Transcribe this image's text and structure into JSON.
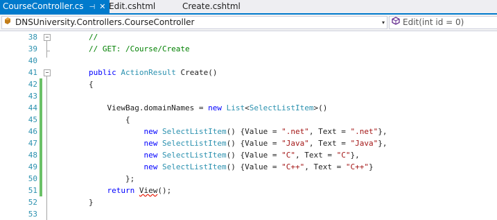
{
  "tabs": [
    {
      "label": "CourseController.cs",
      "active": true
    },
    {
      "label": "Edit.cshtml",
      "active": false
    },
    {
      "label": "Create.cshtml",
      "active": false
    }
  ],
  "navbar": {
    "class_selector": "DNSUniversity.Controllers.CourseController",
    "member_selector": "Edit(int id = 0)"
  },
  "editor": {
    "lines": [
      {
        "num": "38",
        "tokens": [
          {
            "t": "        //",
            "c": "cm"
          }
        ]
      },
      {
        "num": "39",
        "tokens": [
          {
            "t": "        // GET: /Course/Create",
            "c": "cm"
          }
        ]
      },
      {
        "num": "40",
        "tokens": [
          {
            "t": "",
            "c": "pl"
          }
        ]
      },
      {
        "num": "41",
        "tokens": [
          {
            "t": "        ",
            "c": "pl"
          },
          {
            "t": "public",
            "c": "kw"
          },
          {
            "t": " ",
            "c": "pl"
          },
          {
            "t": "ActionResult",
            "c": "ty"
          },
          {
            "t": " Create()",
            "c": "pl"
          }
        ]
      },
      {
        "num": "42",
        "tokens": [
          {
            "t": "        {",
            "c": "pl"
          }
        ]
      },
      {
        "num": "43",
        "tokens": [
          {
            "t": "",
            "c": "pl"
          }
        ]
      },
      {
        "num": "44",
        "tokens": [
          {
            "t": "            ViewBag.domainNames = ",
            "c": "pl"
          },
          {
            "t": "new",
            "c": "kw"
          },
          {
            "t": " ",
            "c": "pl"
          },
          {
            "t": "List",
            "c": "ty"
          },
          {
            "t": "<",
            "c": "pl"
          },
          {
            "t": "SelectListItem",
            "c": "ty"
          },
          {
            "t": ">()",
            "c": "pl"
          }
        ]
      },
      {
        "num": "45",
        "tokens": [
          {
            "t": "                {",
            "c": "pl"
          }
        ]
      },
      {
        "num": "46",
        "tokens": [
          {
            "t": "                    ",
            "c": "pl"
          },
          {
            "t": "new",
            "c": "kw"
          },
          {
            "t": " ",
            "c": "pl"
          },
          {
            "t": "SelectListItem",
            "c": "ty"
          },
          {
            "t": "() {Value = ",
            "c": "pl"
          },
          {
            "t": "\".net\"",
            "c": "st"
          },
          {
            "t": ", Text = ",
            "c": "pl"
          },
          {
            "t": "\".net\"",
            "c": "st"
          },
          {
            "t": "},",
            "c": "pl"
          }
        ]
      },
      {
        "num": "47",
        "tokens": [
          {
            "t": "                    ",
            "c": "pl"
          },
          {
            "t": "new",
            "c": "kw"
          },
          {
            "t": " ",
            "c": "pl"
          },
          {
            "t": "SelectListItem",
            "c": "ty"
          },
          {
            "t": "() {Value = ",
            "c": "pl"
          },
          {
            "t": "\"Java\"",
            "c": "st"
          },
          {
            "t": ", Text = ",
            "c": "pl"
          },
          {
            "t": "\"Java\"",
            "c": "st"
          },
          {
            "t": "},",
            "c": "pl"
          }
        ]
      },
      {
        "num": "48",
        "tokens": [
          {
            "t": "                    ",
            "c": "pl"
          },
          {
            "t": "new",
            "c": "kw"
          },
          {
            "t": " ",
            "c": "pl"
          },
          {
            "t": "SelectListItem",
            "c": "ty"
          },
          {
            "t": "() {Value = ",
            "c": "pl"
          },
          {
            "t": "\"C\"",
            "c": "st"
          },
          {
            "t": ", Text = ",
            "c": "pl"
          },
          {
            "t": "\"C\"",
            "c": "st"
          },
          {
            "t": "},",
            "c": "pl"
          }
        ]
      },
      {
        "num": "49",
        "tokens": [
          {
            "t": "                    ",
            "c": "pl"
          },
          {
            "t": "new",
            "c": "kw"
          },
          {
            "t": " ",
            "c": "pl"
          },
          {
            "t": "SelectListItem",
            "c": "ty"
          },
          {
            "t": "() {Value = ",
            "c": "pl"
          },
          {
            "t": "\"C++\"",
            "c": "st"
          },
          {
            "t": ", Text = ",
            "c": "pl"
          },
          {
            "t": "\"C++\"",
            "c": "st"
          },
          {
            "t": "}",
            "c": "pl"
          }
        ]
      },
      {
        "num": "50",
        "tokens": [
          {
            "t": "                };",
            "c": "pl"
          }
        ]
      },
      {
        "num": "51",
        "tokens": [
          {
            "t": "            ",
            "c": "pl"
          },
          {
            "t": "return",
            "c": "kw"
          },
          {
            "t": " ",
            "c": "pl"
          },
          {
            "t": "View",
            "c": "sq"
          },
          {
            "t": "();",
            "c": "pl"
          }
        ]
      },
      {
        "num": "52",
        "tokens": [
          {
            "t": "        }",
            "c": "pl"
          }
        ]
      },
      {
        "num": "53",
        "tokens": [
          {
            "t": "",
            "c": "pl"
          }
        ]
      }
    ]
  },
  "colors": {
    "accent": "#007acc",
    "keyword": "#0000ff",
    "type": "#2b91af",
    "comment": "#008000",
    "string": "#a31515",
    "line_number": "#2b91af",
    "change_bar": "#6bc168"
  }
}
